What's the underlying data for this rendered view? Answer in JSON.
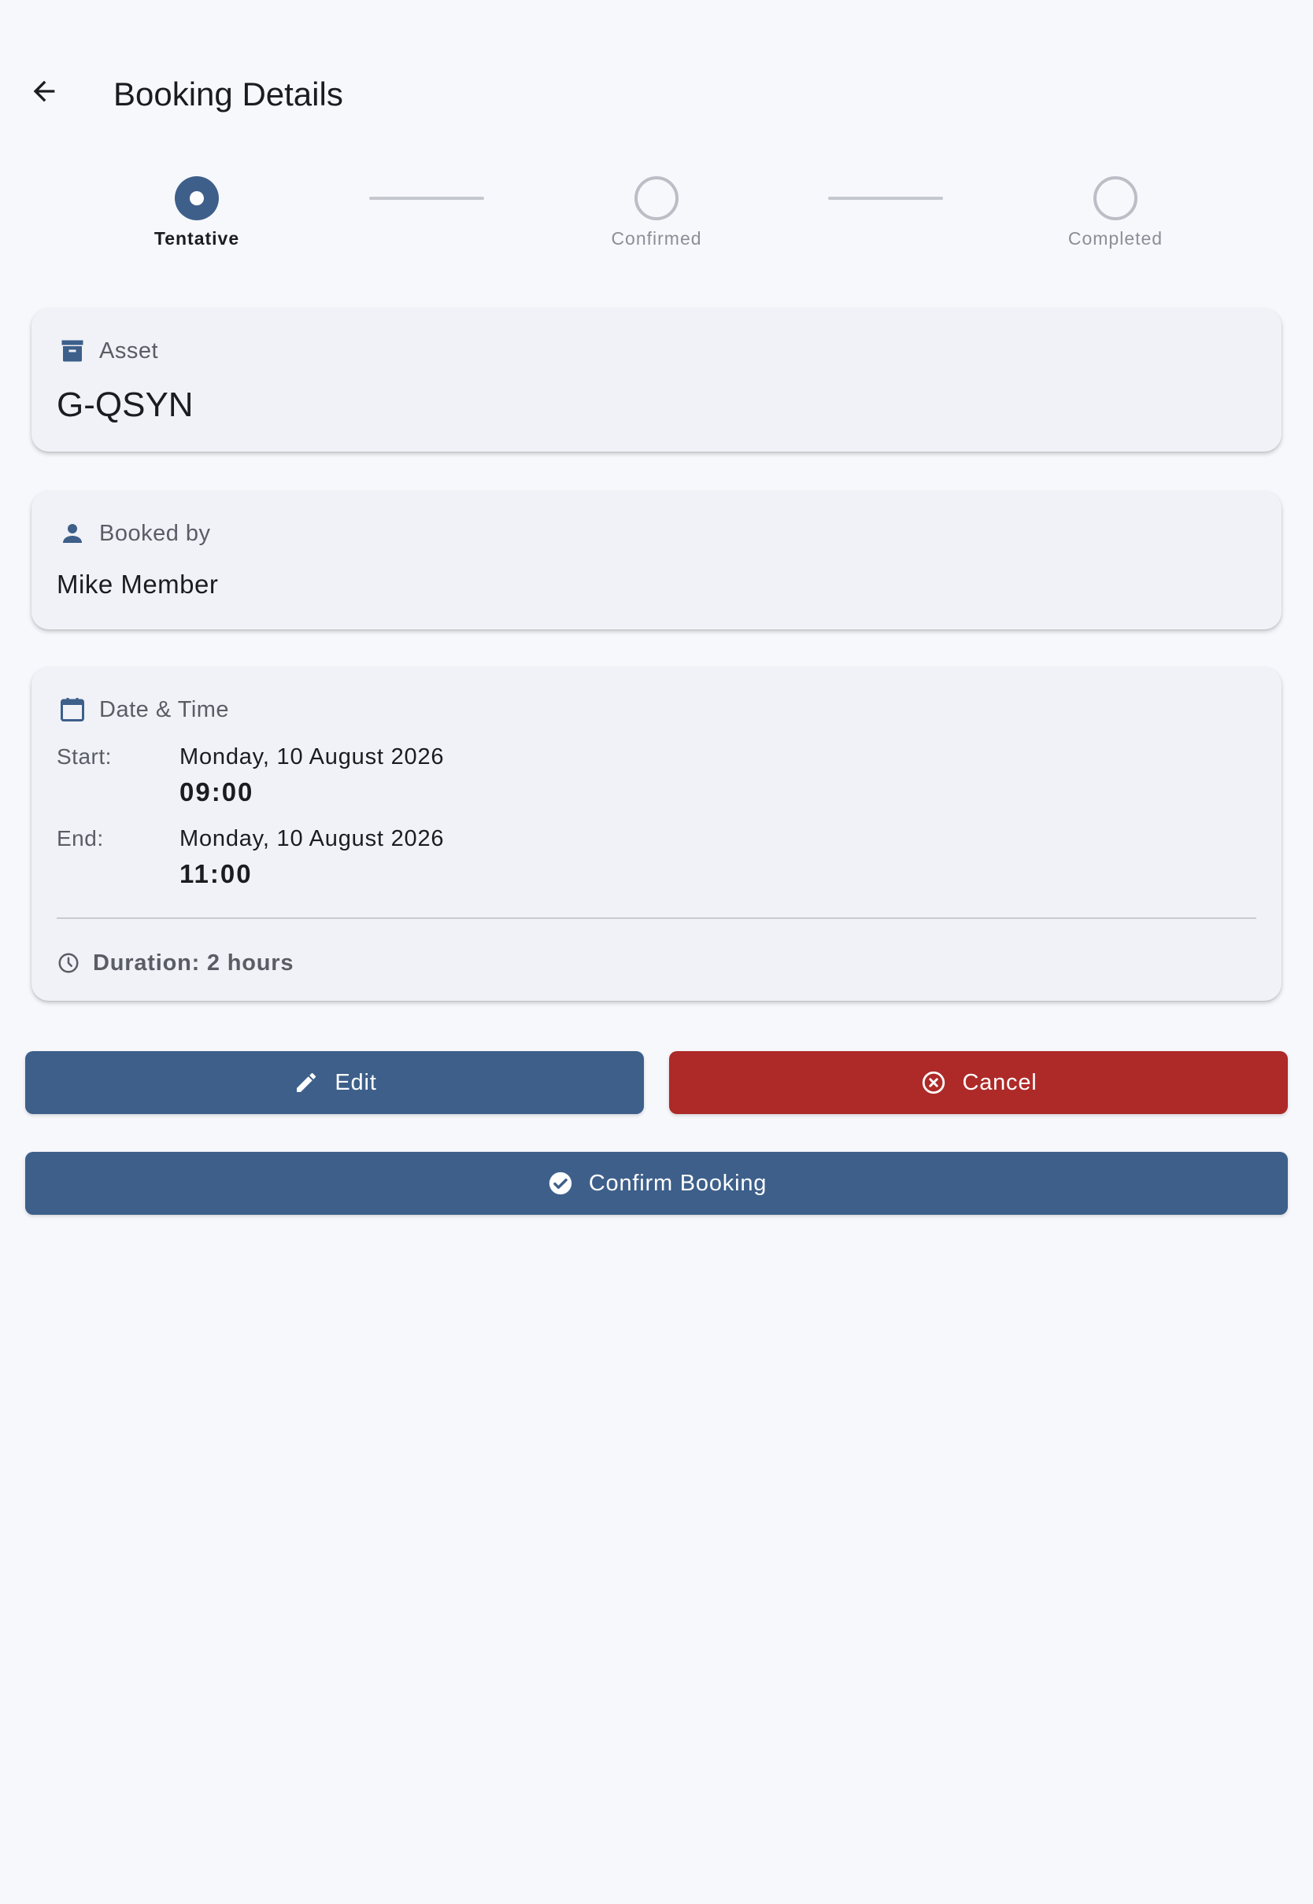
{
  "header": {
    "title": "Booking Details",
    "back_icon": "arrow-back-icon"
  },
  "stepper": {
    "current_step": 0,
    "steps": [
      {
        "label": "Tentative",
        "state": "active"
      },
      {
        "label": "Confirmed",
        "state": "inactive"
      },
      {
        "label": "Completed",
        "state": "inactive"
      }
    ]
  },
  "asset_card": {
    "label": "Asset",
    "icon": "archive-box-icon",
    "value": "G-QSYN"
  },
  "booked_by_card": {
    "label": "Booked by",
    "icon": "person-icon",
    "value": "Mike Member"
  },
  "datetime_card": {
    "label": "Date & Time",
    "icon": "calendar-icon",
    "start": {
      "key": "Start:",
      "date": "Monday, 10 August 2026",
      "time": "09:00"
    },
    "end": {
      "key": "End:",
      "date": "Monday, 10 August 2026",
      "time": "11:00"
    },
    "duration": "Duration: 2 hours",
    "duration_icon": "clock-icon"
  },
  "actions": {
    "edit_label": "Edit",
    "cancel_label": "Cancel",
    "confirm_label": "Confirm Booking"
  },
  "colors": {
    "primary": "#3d5f8a",
    "danger": "#ad2a28",
    "background": "#f7f8fc",
    "card": "#f1f2f7"
  }
}
